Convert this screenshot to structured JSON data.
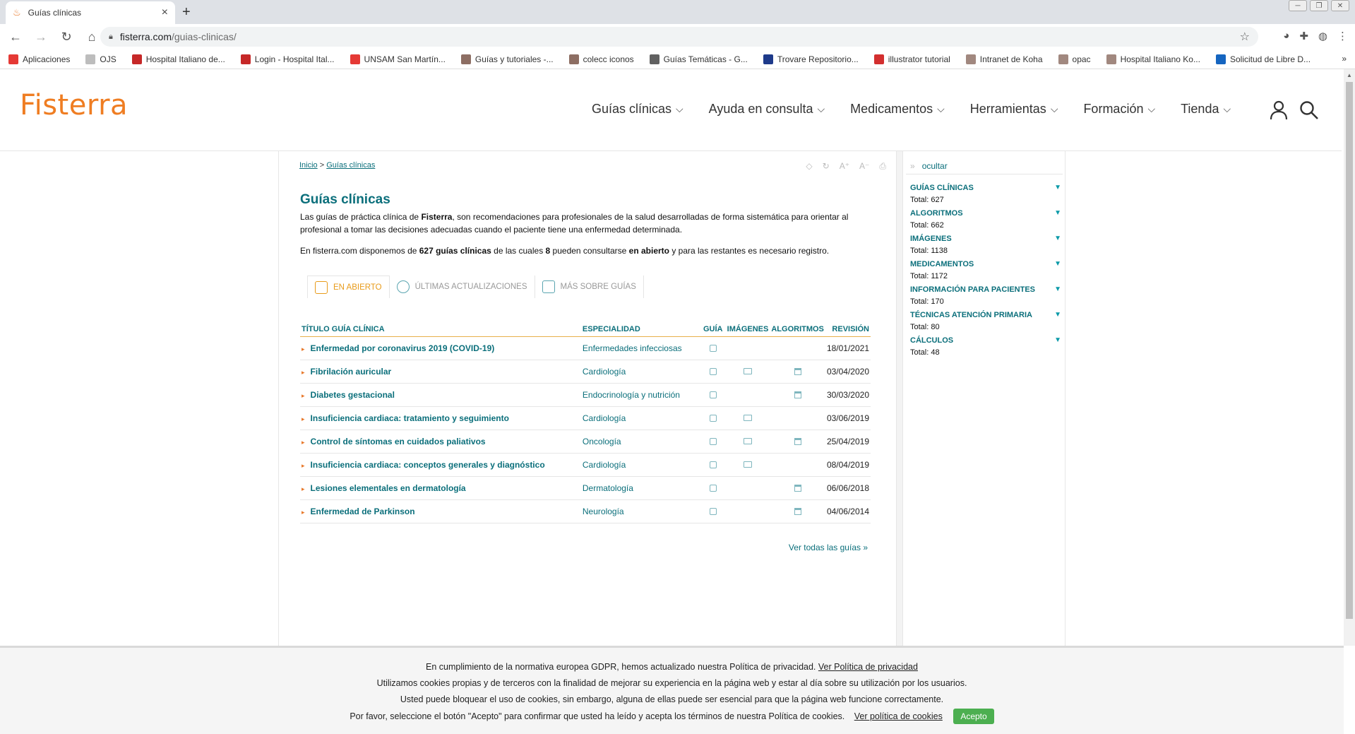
{
  "browser": {
    "tab_title": "Guías clínicas",
    "url_domain": "fisterra.com",
    "url_path": "/guias-clinicas/",
    "bookmarks": [
      {
        "label": "Aplicaciones",
        "color": "#e53935"
      },
      {
        "label": "OJS",
        "color": "#bdbdbd"
      },
      {
        "label": "Hospital Italiano de...",
        "color": "#c62828"
      },
      {
        "label": "Login - Hospital Ital...",
        "color": "#c62828"
      },
      {
        "label": "UNSAM San Martín...",
        "color": "#e53935"
      },
      {
        "label": "Guías y tutoriales -...",
        "color": "#8d6e63"
      },
      {
        "label": "colecc iconos",
        "color": "#8d6e63"
      },
      {
        "label": "Guías Temáticas - G...",
        "color": "#616161"
      },
      {
        "label": "Trovare Repositorio...",
        "color": "#1e3a8a"
      },
      {
        "label": "illustrator tutorial",
        "color": "#d32f2f"
      },
      {
        "label": "Intranet de Koha",
        "color": "#a1887f"
      },
      {
        "label": "opac",
        "color": "#a1887f"
      },
      {
        "label": "Hospital Italiano Ko...",
        "color": "#a1887f"
      },
      {
        "label": "Solicitud de Libre D...",
        "color": "#1565c0"
      }
    ],
    "bookmarks_more": "»"
  },
  "site": {
    "logo": "Fisterra",
    "nav": [
      "Guías clínicas",
      "Ayuda en consulta",
      "Medicamentos",
      "Herramientas",
      "Formación",
      "Tienda"
    ]
  },
  "page": {
    "breadcrumb_home": "Inicio",
    "breadcrumb_sep": ">",
    "breadcrumb_current": "Guías clínicas",
    "title": "Guías clínicas",
    "intro_a": "Las guías de práctica clínica de ",
    "intro_brand": "Fisterra",
    "intro_b": ", son recomendaciones para profesionales de la salud desarrolladas de forma sistemática para orientar al profesional a tomar las decisiones adecuadas cuando el paciente tiene una enfermedad determinada.",
    "avail_a": "En fisterra.com disponemos de ",
    "avail_count": "627 guías clínicas",
    "avail_b": " de las cuales ",
    "avail_open_count": "8",
    "avail_c": " pueden consultarse ",
    "avail_open": "en abierto",
    "avail_d": " y para las restantes es necesario registro.",
    "tabs": [
      "EN ABIERTO",
      "ÚLTIMAS ACTUALIZACIONES",
      "MÁS SOBRE GUÍAS"
    ],
    "table_headers": [
      "TÍTULO GUÍA CLÍNICA",
      "ESPECIALIDAD",
      "GUÍA",
      "IMÁGENES",
      "ALGORITMOS",
      "REVISIÓN"
    ],
    "rows": [
      {
        "title": "Enfermedad por coronavirus 2019 (COVID-19)",
        "especialidad": "Enfermedades infecciosas",
        "guia": true,
        "imagenes": false,
        "algoritmos": false,
        "revision": "18/01/2021"
      },
      {
        "title": "Fibrilación auricular",
        "especialidad": "Cardiología",
        "guia": true,
        "imagenes": true,
        "algoritmos": true,
        "revision": "03/04/2020"
      },
      {
        "title": "Diabetes gestacional",
        "especialidad": "Endocrinología y nutrición",
        "guia": true,
        "imagenes": false,
        "algoritmos": true,
        "revision": "30/03/2020"
      },
      {
        "title": "Insuficiencia cardiaca: tratamiento y seguimiento",
        "especialidad": "Cardiología",
        "guia": true,
        "imagenes": true,
        "algoritmos": false,
        "revision": "03/06/2019"
      },
      {
        "title": "Control de síntomas en cuidados paliativos",
        "especialidad": "Oncología",
        "guia": true,
        "imagenes": true,
        "algoritmos": true,
        "revision": "25/04/2019"
      },
      {
        "title": "Insuficiencia cardiaca: conceptos generales y diagnóstico",
        "especialidad": "Cardiología",
        "guia": true,
        "imagenes": true,
        "algoritmos": false,
        "revision": "08/04/2019"
      },
      {
        "title": "Lesiones elementales en dermatología",
        "especialidad": "Dermatología",
        "guia": true,
        "imagenes": false,
        "algoritmos": true,
        "revision": "06/06/2018"
      },
      {
        "title": "Enfermedad de Parkinson",
        "especialidad": "Neurología",
        "guia": true,
        "imagenes": false,
        "algoritmos": true,
        "revision": "04/06/2014"
      }
    ],
    "ver_todas": "Ver todas las guías »"
  },
  "sidebar": {
    "ocultar": "ocultar",
    "items": [
      {
        "name": "GUÍAS CLÍNICAS",
        "total": "Total: 627"
      },
      {
        "name": "ALGORITMOS",
        "total": "Total: 662"
      },
      {
        "name": "IMÁGENES",
        "total": "Total: 1138"
      },
      {
        "name": "MEDICAMENTOS",
        "total": "Total: 1172"
      },
      {
        "name": "INFORMACIÓN PARA PACIENTES",
        "total": "Total: 170"
      },
      {
        "name": "TÉCNICAS ATENCIÓN PRIMARIA",
        "total": "Total: 80"
      },
      {
        "name": "CÁLCULOS",
        "total": "Total: 48"
      }
    ]
  },
  "cookie": {
    "line1": "En cumplimiento de la normativa europea GDPR, hemos actualizado nuestra Política de privacidad.",
    "link1": "Ver Política de privacidad",
    "line2": "Utilizamos cookies propias y de terceros con la finalidad de mejorar su experiencia en la página web y estar al día sobre su utilización por los usuarios.",
    "line3": "Usted puede bloquear el uso de cookies, sin embargo, alguna de ellas puede ser esencial para que la página web funcione correctamente.",
    "line4": "Por favor, seleccione el botón \"Acepto\" para confirmar que usted ha leído y acepta los términos de nuestra Política de cookies.",
    "link2": "Ver política de cookies",
    "accept": "Acepto"
  },
  "colors": {
    "brand_orange": "#ef7d22",
    "teal": "#0b6f7b",
    "accept_green": "#4caf50"
  }
}
